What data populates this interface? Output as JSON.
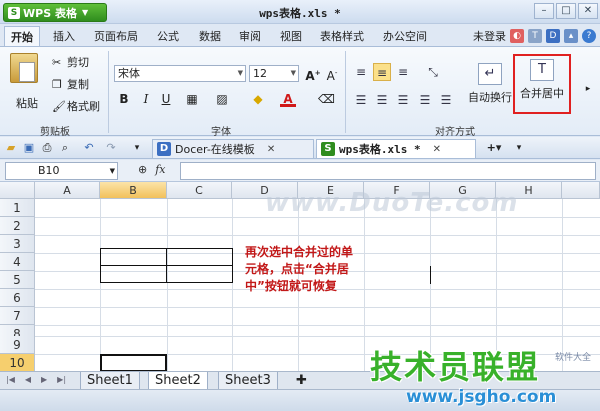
{
  "app": {
    "name": "WPS 表格",
    "doc_title": "wps表格.xls *"
  },
  "menu": {
    "tabs": [
      "开始",
      "插入",
      "页面布局",
      "公式",
      "数据",
      "审阅",
      "视图",
      "表格样式",
      "办公空间"
    ],
    "login": "未登录"
  },
  "ribbon": {
    "clipboard": {
      "paste": "粘贴",
      "cut": "剪切",
      "copy": "复制",
      "format_painter": "格式刷",
      "group": "剪贴板"
    },
    "font": {
      "name": "宋体",
      "size": "12",
      "bold": "B",
      "italic": "I",
      "underline": "U",
      "group": "字体"
    },
    "alignment": {
      "wrap": "自动换行",
      "merge": "合并居中",
      "group": "对齐方式"
    }
  },
  "doc_tabs": [
    {
      "label": "Docer-在线模板",
      "icon": "D"
    },
    {
      "label": "wps表格.xls *",
      "icon": "S"
    }
  ],
  "formula_bar": {
    "cell_ref": "B10",
    "fx": "fx"
  },
  "grid": {
    "columns": [
      "A",
      "B",
      "C",
      "D",
      "E",
      "F",
      "G",
      "H"
    ],
    "selected_column": "B",
    "rows": [
      "1",
      "2",
      "3",
      "4",
      "5",
      "6",
      "7",
      "8",
      "9",
      "10"
    ],
    "selected_row": "10",
    "note_lines": [
      "再次选中合并过的单",
      "元格，点击“合并居",
      "中”按钮就可恢复"
    ],
    "watermark": "www.DuoTe.com"
  },
  "sheets": [
    "Sheet1",
    "Sheet2",
    "Sheet3"
  ],
  "site_logo": {
    "brand": "技术员联盟",
    "url": "www.jsgho.com",
    "tag": "软件大全"
  }
}
